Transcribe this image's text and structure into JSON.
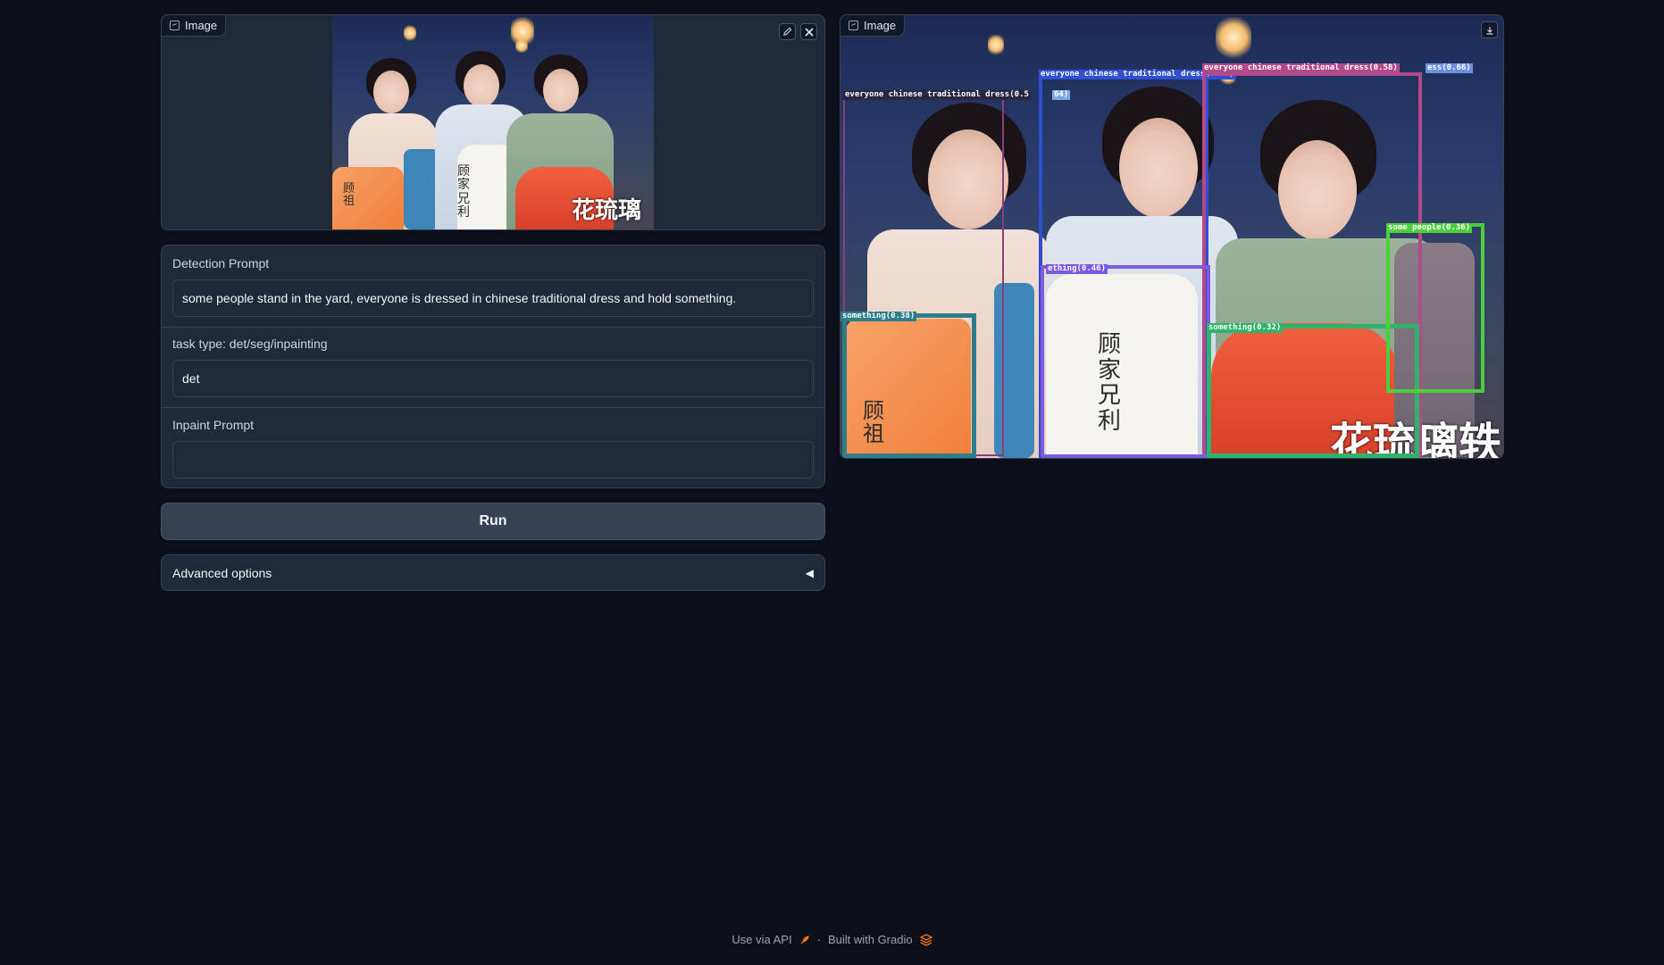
{
  "input_image": {
    "label": "Image",
    "edit_icon": "pencil-icon",
    "clear_icon": "close-icon"
  },
  "output_image": {
    "label": "Image",
    "download_icon": "download-icon"
  },
  "form": {
    "detection_prompt_label": "Detection Prompt",
    "detection_prompt_value": "some people stand in the yard, everyone is dressed in chinese traditional dress and hold something.",
    "task_type_label": "task type: det/seg/inpainting",
    "task_type_value": "det",
    "inpaint_prompt_label": "Inpaint Prompt",
    "inpaint_prompt_value": ""
  },
  "run_button": "Run",
  "advanced_options": {
    "label": "Advanced options",
    "toggle": "◀"
  },
  "watermark": "花琉璃轶",
  "calligraphy": {
    "left": "顾\n祖",
    "middle": "顾\n家\n兄\n利"
  },
  "detections": [
    {
      "label": "everyone chinese traditional dress(0.5",
      "color": "#ffffff"
    },
    {
      "label": "64)",
      "color": "#7fa7e6"
    },
    {
      "label": "everyone chinese traditional dress(0.40)",
      "color": "#2f4fd1"
    },
    {
      "label": "everyone chinese traditional dress(0.58)",
      "color": "#b04a8a"
    },
    {
      "label": "ess(0.66)",
      "color": "#6e8ee0"
    },
    {
      "label": "ething(0.46)",
      "color": "#7b5be0"
    },
    {
      "label": "something(0.38)",
      "color": "#2e7d8a"
    },
    {
      "label": "something(0.32)",
      "color": "#2fb36a"
    },
    {
      "label": "some people(0.36)",
      "color": "#4ccf3a"
    }
  ],
  "footer": {
    "api": "Use via API",
    "separator": "·",
    "built": "Built with Gradio",
    "rocket_icon": "rocket-icon",
    "gradio_icon": "gradio-logo-icon"
  }
}
